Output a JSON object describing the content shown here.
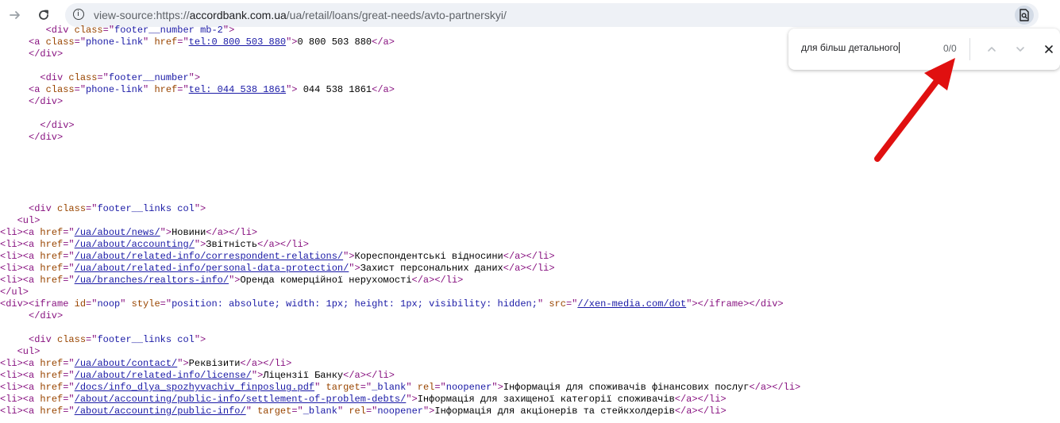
{
  "browser": {
    "url_prefix": "view-source:https://",
    "url_host": "accordbank.com.ua",
    "url_path": "/ua/retail/loans/great-needs/avto-partnerskyi/"
  },
  "find_bar": {
    "query": "для більш детального",
    "count": "0/0"
  },
  "colors": {
    "tag": "#881280",
    "attribute": "#994500",
    "value": "#1a1aa6",
    "annotation_arrow": "#e01010"
  },
  "source_lines": [
    [
      {
        "c": "t",
        "x": "        <div "
      },
      {
        "c": "a",
        "x": "class"
      },
      {
        "c": "t",
        "x": "=\""
      },
      {
        "c": "v",
        "x": "footer__number mb-2"
      },
      {
        "c": "t",
        "x": "\">"
      }
    ],
    [
      {
        "c": "t",
        "x": "     <a "
      },
      {
        "c": "a",
        "x": "class"
      },
      {
        "c": "t",
        "x": "=\""
      },
      {
        "c": "v",
        "x": "phone-link"
      },
      {
        "c": "t",
        "x": "\" "
      },
      {
        "c": "a",
        "x": "href"
      },
      {
        "c": "t",
        "x": "=\""
      },
      {
        "c": "l",
        "x": "tel:0 800 503 880"
      },
      {
        "c": "t",
        "x": "\">"
      },
      {
        "c": "",
        "x": "0 800 503 880"
      },
      {
        "c": "t",
        "x": "</a>"
      }
    ],
    [
      {
        "c": "t",
        "x": "     </div>"
      }
    ],
    [
      {
        "c": "",
        "x": ""
      }
    ],
    [
      {
        "c": "t",
        "x": "       <div "
      },
      {
        "c": "a",
        "x": "class"
      },
      {
        "c": "t",
        "x": "=\""
      },
      {
        "c": "v",
        "x": "footer__number"
      },
      {
        "c": "t",
        "x": "\">"
      }
    ],
    [
      {
        "c": "t",
        "x": "     <a "
      },
      {
        "c": "a",
        "x": "class"
      },
      {
        "c": "t",
        "x": "=\""
      },
      {
        "c": "v",
        "x": "phone-link"
      },
      {
        "c": "t",
        "x": "\" "
      },
      {
        "c": "a",
        "x": "href"
      },
      {
        "c": "t",
        "x": "=\""
      },
      {
        "c": "l",
        "x": "tel: 044 538 1861"
      },
      {
        "c": "t",
        "x": "\">"
      },
      {
        "c": "",
        "x": " 044 538 1861"
      },
      {
        "c": "t",
        "x": "</a>"
      }
    ],
    [
      {
        "c": "t",
        "x": "     </div>"
      }
    ],
    [
      {
        "c": "",
        "x": ""
      }
    ],
    [
      {
        "c": "t",
        "x": "       </div>"
      }
    ],
    [
      {
        "c": "t",
        "x": "     </div>"
      }
    ],
    [
      {
        "c": "",
        "x": ""
      }
    ],
    [
      {
        "c": "",
        "x": ""
      }
    ],
    [
      {
        "c": "",
        "x": ""
      }
    ],
    [
      {
        "c": "",
        "x": ""
      }
    ],
    [
      {
        "c": "",
        "x": ""
      }
    ],
    [
      {
        "c": "t",
        "x": "     <div "
      },
      {
        "c": "a",
        "x": "class"
      },
      {
        "c": "t",
        "x": "=\""
      },
      {
        "c": "v",
        "x": "footer__links col"
      },
      {
        "c": "t",
        "x": "\">"
      }
    ],
    [
      {
        "c": "t",
        "x": "   <ul>"
      }
    ],
    [
      {
        "c": "t",
        "x": "<li><a "
      },
      {
        "c": "a",
        "x": "href"
      },
      {
        "c": "t",
        "x": "=\""
      },
      {
        "c": "l",
        "x": "/ua/about/news/"
      },
      {
        "c": "t",
        "x": "\">"
      },
      {
        "c": "",
        "x": "Новини"
      },
      {
        "c": "t",
        "x": "</a></li>"
      }
    ],
    [
      {
        "c": "t",
        "x": "<li><a "
      },
      {
        "c": "a",
        "x": "href"
      },
      {
        "c": "t",
        "x": "=\""
      },
      {
        "c": "l",
        "x": "/ua/about/accounting/"
      },
      {
        "c": "t",
        "x": "\">"
      },
      {
        "c": "",
        "x": "Звітність"
      },
      {
        "c": "t",
        "x": "</a></li>"
      }
    ],
    [
      {
        "c": "t",
        "x": "<li><a "
      },
      {
        "c": "a",
        "x": "href"
      },
      {
        "c": "t",
        "x": "=\""
      },
      {
        "c": "l",
        "x": "/ua/about/related-info/correspondent-relations/"
      },
      {
        "c": "t",
        "x": "\">"
      },
      {
        "c": "",
        "x": "Кореспондентські відносини"
      },
      {
        "c": "t",
        "x": "</a></li>"
      }
    ],
    [
      {
        "c": "t",
        "x": "<li><a "
      },
      {
        "c": "a",
        "x": "href"
      },
      {
        "c": "t",
        "x": "=\""
      },
      {
        "c": "l",
        "x": "/ua/about/related-info/personal-data-protection/"
      },
      {
        "c": "t",
        "x": "\">"
      },
      {
        "c": "",
        "x": "Захист персональних даних"
      },
      {
        "c": "t",
        "x": "</a></li>"
      }
    ],
    [
      {
        "c": "t",
        "x": "<li><a "
      },
      {
        "c": "a",
        "x": "href"
      },
      {
        "c": "t",
        "x": "=\""
      },
      {
        "c": "l",
        "x": "/ua/branches/realtors-info/"
      },
      {
        "c": "t",
        "x": "\">"
      },
      {
        "c": "",
        "x": "Оренда комерційної нерухомості"
      },
      {
        "c": "t",
        "x": "</a></li>"
      }
    ],
    [
      {
        "c": "t",
        "x": "</ul>"
      }
    ],
    [
      {
        "c": "t",
        "x": "<div><iframe "
      },
      {
        "c": "a",
        "x": "id"
      },
      {
        "c": "t",
        "x": "=\""
      },
      {
        "c": "v",
        "x": "noop"
      },
      {
        "c": "t",
        "x": "\" "
      },
      {
        "c": "a",
        "x": "style"
      },
      {
        "c": "t",
        "x": "=\""
      },
      {
        "c": "v",
        "x": "position: absolute; width: 1px; height: 1px; visibility: hidden;"
      },
      {
        "c": "t",
        "x": "\" "
      },
      {
        "c": "a",
        "x": "src"
      },
      {
        "c": "t",
        "x": "=\""
      },
      {
        "c": "l",
        "x": "//xen-media.com/dot"
      },
      {
        "c": "t",
        "x": "\"></iframe></div>"
      }
    ],
    [
      {
        "c": "t",
        "x": "     </div>"
      }
    ],
    [
      {
        "c": "",
        "x": ""
      }
    ],
    [
      {
        "c": "t",
        "x": "     <div "
      },
      {
        "c": "a",
        "x": "class"
      },
      {
        "c": "t",
        "x": "=\""
      },
      {
        "c": "v",
        "x": "footer__links col"
      },
      {
        "c": "t",
        "x": "\">"
      }
    ],
    [
      {
        "c": "t",
        "x": "   <ul>"
      }
    ],
    [
      {
        "c": "t",
        "x": "<li><a "
      },
      {
        "c": "a",
        "x": "href"
      },
      {
        "c": "t",
        "x": "=\""
      },
      {
        "c": "l",
        "x": "/ua/about/contact/"
      },
      {
        "c": "t",
        "x": "\">"
      },
      {
        "c": "",
        "x": "Реквізити"
      },
      {
        "c": "t",
        "x": "</a></li>"
      }
    ],
    [
      {
        "c": "t",
        "x": "<li><a "
      },
      {
        "c": "a",
        "x": "href"
      },
      {
        "c": "t",
        "x": "=\""
      },
      {
        "c": "l",
        "x": "/ua/about/related-info/license/"
      },
      {
        "c": "t",
        "x": "\">"
      },
      {
        "c": "",
        "x": "Ліцензії Банку"
      },
      {
        "c": "t",
        "x": "</a></li>"
      }
    ],
    [
      {
        "c": "t",
        "x": "<li><a "
      },
      {
        "c": "a",
        "x": "href"
      },
      {
        "c": "t",
        "x": "=\""
      },
      {
        "c": "l",
        "x": "/docs/info_dlya_spozhyvachiv_finposlug.pdf"
      },
      {
        "c": "t",
        "x": "\" "
      },
      {
        "c": "a",
        "x": "target"
      },
      {
        "c": "t",
        "x": "=\""
      },
      {
        "c": "v",
        "x": "_blank"
      },
      {
        "c": "t",
        "x": "\" "
      },
      {
        "c": "a",
        "x": "rel"
      },
      {
        "c": "t",
        "x": "=\""
      },
      {
        "c": "v",
        "x": "noopener"
      },
      {
        "c": "t",
        "x": "\">"
      },
      {
        "c": "",
        "x": "Інформація для споживачів фінансових послуг"
      },
      {
        "c": "t",
        "x": "</a></li>"
      }
    ],
    [
      {
        "c": "t",
        "x": "<li><a "
      },
      {
        "c": "a",
        "x": "href"
      },
      {
        "c": "t",
        "x": "=\""
      },
      {
        "c": "l",
        "x": "/about/accounting/public-info/settlement-of-problem-debts/"
      },
      {
        "c": "t",
        "x": "\">"
      },
      {
        "c": "",
        "x": "Інформація для захищеної категорії споживачів"
      },
      {
        "c": "t",
        "x": "</a></li>"
      }
    ],
    [
      {
        "c": "t",
        "x": "<li><a "
      },
      {
        "c": "a",
        "x": "href"
      },
      {
        "c": "t",
        "x": "=\""
      },
      {
        "c": "l",
        "x": "/about/accounting/public-info/"
      },
      {
        "c": "t",
        "x": "\" "
      },
      {
        "c": "a",
        "x": "target"
      },
      {
        "c": "t",
        "x": "=\""
      },
      {
        "c": "v",
        "x": "_blank"
      },
      {
        "c": "t",
        "x": "\" "
      },
      {
        "c": "a",
        "x": "rel"
      },
      {
        "c": "t",
        "x": "=\""
      },
      {
        "c": "v",
        "x": "noopener"
      },
      {
        "c": "t",
        "x": "\">"
      },
      {
        "c": "",
        "x": "Інформація для акціонерів та стейкхолдерів"
      },
      {
        "c": "t",
        "x": "</a></li>"
      }
    ]
  ]
}
